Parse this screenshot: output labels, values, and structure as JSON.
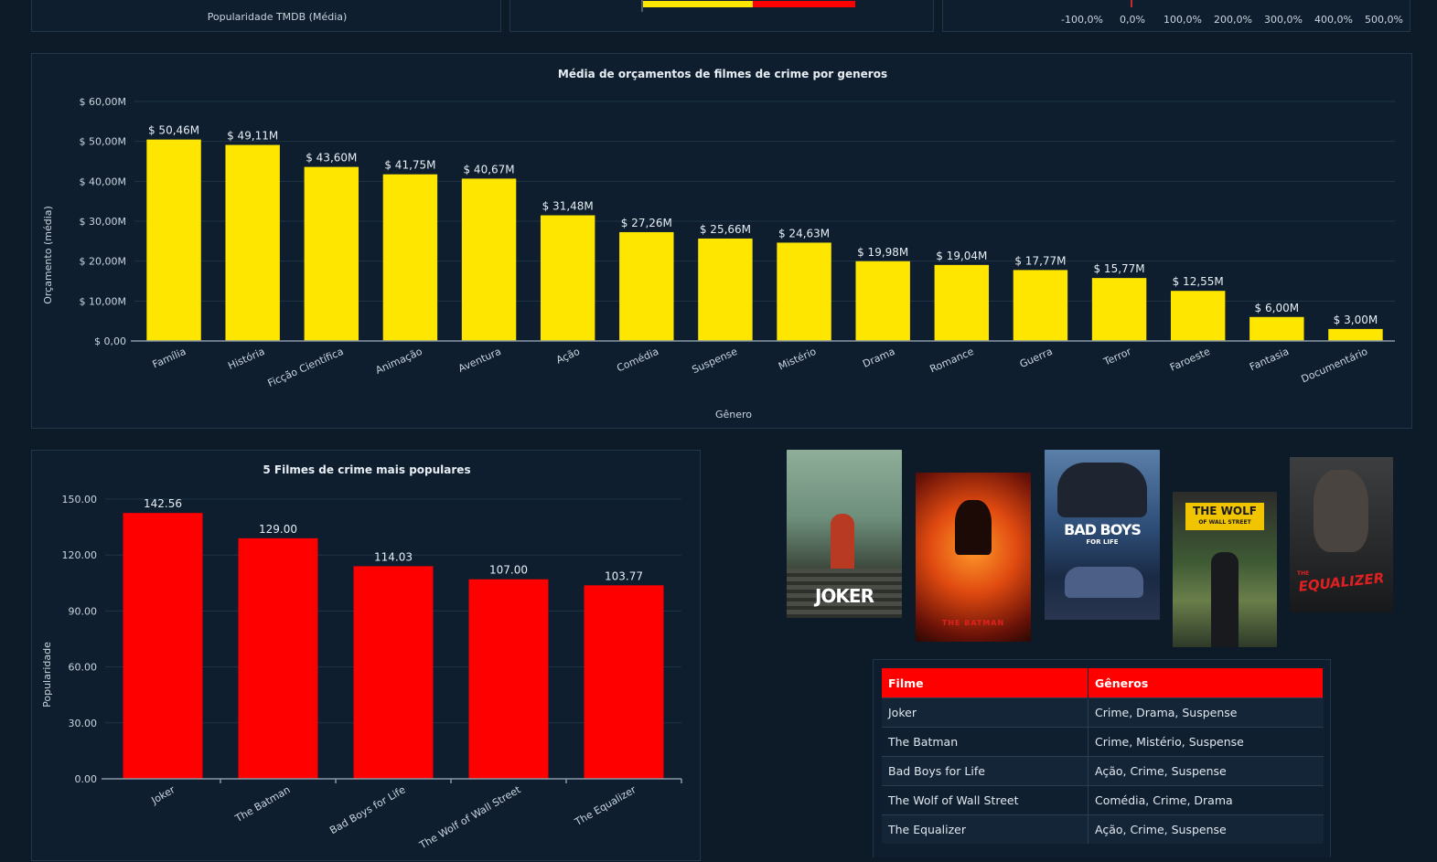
{
  "top_panels": {
    "left_axis_label": "Popularidade TMDB (Média)",
    "right_ticks": [
      "-100,0%",
      "0,0%",
      "100,0%",
      "200,0%",
      "300,0%",
      "400,0%",
      "500,0%"
    ],
    "middle_bar_colors": [
      "#ffe600",
      "#ff0000"
    ]
  },
  "chart_data": [
    {
      "type": "bar",
      "title": "Média de orçamentos de filmes de crime por generos",
      "xlabel": "Gênero",
      "ylabel": "Orçamento (média)",
      "categories": [
        "Família",
        "História",
        "Ficção Científica",
        "Animação",
        "Aventura",
        "Ação",
        "Comédia",
        "Suspense",
        "Mistério",
        "Drama",
        "Romance",
        "Guerra",
        "Terror",
        "Faroeste",
        "Fantasia",
        "Documentário"
      ],
      "values": [
        50.46,
        49.11,
        43.6,
        41.75,
        40.67,
        31.48,
        27.26,
        25.66,
        24.63,
        19.98,
        19.04,
        17.77,
        15.77,
        12.55,
        6.0,
        3.0
      ],
      "value_labels": [
        "$ 50,46M",
        "$ 49,11M",
        "$ 43,60M",
        "$ 41,75M",
        "$ 40,67M",
        "$ 31,48M",
        "$ 27,26M",
        "$ 25,66M",
        "$ 24,63M",
        "$ 19,98M",
        "$ 19,04M",
        "$ 17,77M",
        "$ 15,77M",
        "$ 12,55M",
        "$ 6,00M",
        "$ 3,00M"
      ],
      "ylim": [
        0,
        60
      ],
      "y_ticks": [
        0,
        10,
        20,
        30,
        40,
        50,
        60
      ],
      "y_tick_labels": [
        "$ 0,00",
        "$ 10,00M",
        "$ 20,00M",
        "$ 30,00M",
        "$ 40,00M",
        "$ 50,00M",
        "$ 60,00M"
      ],
      "color": "#ffe600",
      "grid": true
    },
    {
      "type": "bar",
      "title": "5 Filmes de crime mais populares",
      "xlabel": "",
      "ylabel": "Popularidade",
      "categories": [
        "Joker",
        "The Batman",
        "Bad Boys for Life",
        "The Wolf of Wall Street",
        "The Equalizer"
      ],
      "values": [
        142.56,
        129.0,
        114.03,
        107.0,
        103.77
      ],
      "value_labels": [
        "142.56",
        "129.00",
        "114.03",
        "107.00",
        "103.77"
      ],
      "ylim": [
        0,
        150
      ],
      "y_ticks": [
        0,
        30,
        60,
        90,
        120,
        150
      ],
      "y_tick_labels": [
        "0.00",
        "30.00",
        "60.00",
        "90.00",
        "120.00",
        "150.00"
      ],
      "color": "#ff0000",
      "grid": true
    }
  ],
  "posters": [
    {
      "title": "JOKER"
    },
    {
      "title": "THE BATMAN"
    },
    {
      "title": "BAD BOYS",
      "subtitle": "FOR LIFE"
    },
    {
      "title": "THE WOLF",
      "subtitle": "OF WALL STREET"
    },
    {
      "title": "EQUALIZER",
      "prefix": "THE"
    }
  ],
  "table": {
    "headers": [
      "Filme",
      "Gêneros"
    ],
    "rows": [
      [
        "Joker",
        "Crime, Drama, Suspense"
      ],
      [
        "The Batman",
        "Crime, Mistério, Suspense"
      ],
      [
        "Bad Boys for Life",
        "Ação, Crime, Suspense"
      ],
      [
        "The Wolf of Wall Street",
        "Comédia, Crime, Drama"
      ],
      [
        "The Equalizer",
        "Ação, Crime, Suspense"
      ]
    ]
  }
}
